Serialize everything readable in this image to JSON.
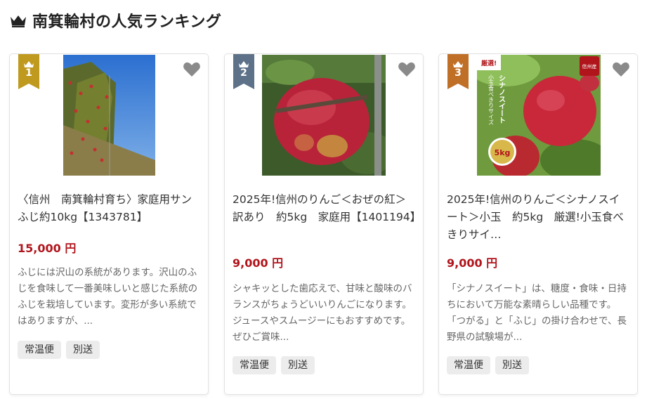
{
  "heading": {
    "title": "南箕輪村の人気ランキング"
  },
  "colors": {
    "rank1": "#c09a1f",
    "rank2": "#5d7188",
    "rank3": "#c06f26",
    "price": "#b0151c",
    "heart": "#8a8a8a"
  },
  "cards": [
    {
      "rank": "1",
      "title": "〈信州　南箕輪村育ち〉家庭用サンふじ約10kg【1343781】",
      "price": "15,000 円",
      "description": "ふじには沢山の系統があります。沢山のふじを食味して一番美味しいと感じた系統のふじを栽培しています。変形が多い系統ではありますが、...",
      "tags": [
        "常温便",
        "別送"
      ]
    },
    {
      "rank": "2",
      "title": "2025年!信州のりんご＜おぜの紅＞訳あり　約5kg　家庭用【1401194】",
      "price": "9,000 円",
      "description": "シャキッとした歯応えで、甘味と酸味のバランスがちょうどいいりんごになります。ジュースやスムージーにもおすすめです。ぜひご賞味...",
      "tags": [
        "常温便",
        "別送"
      ]
    },
    {
      "rank": "3",
      "title": "2025年!信州のりんご＜シナノスイート＞小玉　約5kg　厳選!小玉食べきりサイ…",
      "price": "9,000 円",
      "description": "「シナノスイート」は、糖度・食味・日持ちにおいて万能な素晴らしい品種です。「つがる」と「ふじ」の掛け合わせで、長野県の試験場が...",
      "tags": [
        "常温便",
        "別送"
      ],
      "image_text": {
        "badge": "厳選!",
        "vertical_top": "小玉食べきりサイズ",
        "vertical_main": "シナノスイート",
        "weight": "5kg",
        "brand": "信州産"
      }
    }
  ]
}
